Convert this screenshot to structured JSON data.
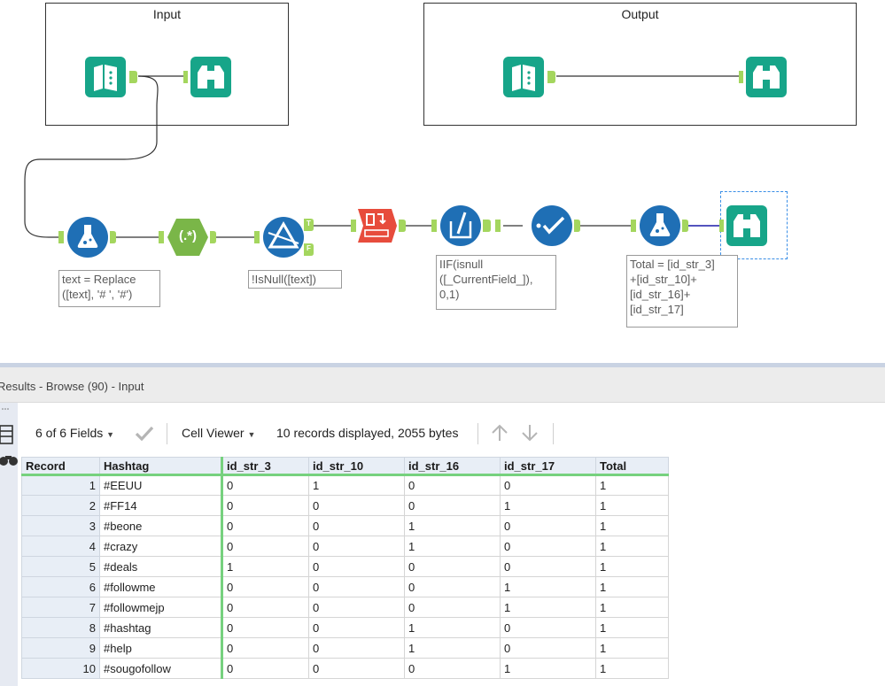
{
  "canvas": {
    "containers": [
      {
        "title": "Input"
      },
      {
        "title": "Output"
      }
    ],
    "annotations": {
      "formula1": "text = Replace\n([text], '# ', '#')",
      "filter": "!IsNull([text])",
      "multi_field_formula": "IIF(isnull\n([_CurrentField_]),\n0,1)",
      "formula2": "Total = [id_str_3]\n+[id_str_10]+\n[id_str_16]+\n[id_str_17]"
    },
    "anchors": {
      "true": "T",
      "false": "F"
    },
    "regex_label": "(.*)",
    "colors": {
      "tool_teal": "#17a589",
      "tool_blue": "#1f6fb5",
      "tool_green": "#7ab648",
      "tool_red": "#e74c3c",
      "anchor_green": "#a4d65e",
      "wire": "#333333",
      "selected_wire": "#1a1aa8"
    }
  },
  "results": {
    "title": "Results - Browse (90) - Input",
    "toolbar": {
      "fields": "6 of 6 Fields",
      "cell_viewer": "Cell Viewer",
      "summary": "10 records displayed, 2055 bytes"
    },
    "columns": [
      "Record",
      "Hashtag",
      "id_str_3",
      "id_str_10",
      "id_str_16",
      "id_str_17",
      "Total"
    ],
    "rows": [
      [
        "1",
        "#EEUU",
        "0",
        "1",
        "0",
        "0",
        "1"
      ],
      [
        "2",
        "#FF14",
        "0",
        "0",
        "0",
        "1",
        "1"
      ],
      [
        "3",
        "#beone",
        "0",
        "0",
        "1",
        "0",
        "1"
      ],
      [
        "4",
        "#crazy",
        "0",
        "0",
        "1",
        "0",
        "1"
      ],
      [
        "5",
        "#deals",
        "1",
        "0",
        "0",
        "0",
        "1"
      ],
      [
        "6",
        "#followme",
        "0",
        "0",
        "0",
        "1",
        "1"
      ],
      [
        "7",
        "#followmejp",
        "0",
        "0",
        "0",
        "1",
        "1"
      ],
      [
        "8",
        "#hashtag",
        "0",
        "0",
        "1",
        "0",
        "1"
      ],
      [
        "9",
        "#help",
        "0",
        "0",
        "1",
        "0",
        "1"
      ],
      [
        "10",
        "#sougofollow",
        "0",
        "0",
        "0",
        "1",
        "1"
      ]
    ]
  }
}
